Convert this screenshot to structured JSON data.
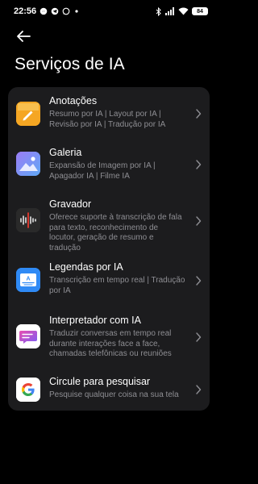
{
  "status_bar": {
    "time": "22:56",
    "left_icons": [
      "messenger-icon",
      "telegram-icon",
      "whatsapp-icon",
      "more-dots-icon"
    ],
    "right_icons": [
      "bluetooth-icon",
      "signal-icon",
      "wifi-icon"
    ],
    "battery": "84"
  },
  "header": {
    "back_icon": "back-arrow-icon",
    "title": "Serviços de IA"
  },
  "services": [
    {
      "title": "Anotações",
      "description": "Resumo por IA | Layout por IA | Revisão por IA | Tradução por IA",
      "icon": "notes-icon",
      "color": "#f5a623"
    },
    {
      "title": "Galeria",
      "description": "Expansão de Imagem por IA | Apagador IA | Filme IA",
      "icon": "gallery-icon",
      "color": "#7b8cf5"
    },
    {
      "title": "Gravador",
      "description": "Oferece suporte à transcrição de fala para texto, reconhecimento de locutor, geração de resumo e tradução",
      "icon": "recorder-icon",
      "color": "#2a2a2a"
    },
    {
      "title": "Legendas por IA",
      "description": "Transcrição em tempo real | Tradução por IA",
      "icon": "subtitles-icon",
      "color": "#2f8af5"
    },
    {
      "title": "Interpretador com IA",
      "description": "Traduzir conversas em tempo real durante interações face a face, chamadas telefônicas ou reuniões",
      "icon": "interpreter-icon",
      "color": "#ffffff"
    },
    {
      "title": "Circule para pesquisar",
      "description": "Pesquise qualquer coisa na sua tela",
      "icon": "google-icon",
      "color": "#ffffff"
    }
  ]
}
